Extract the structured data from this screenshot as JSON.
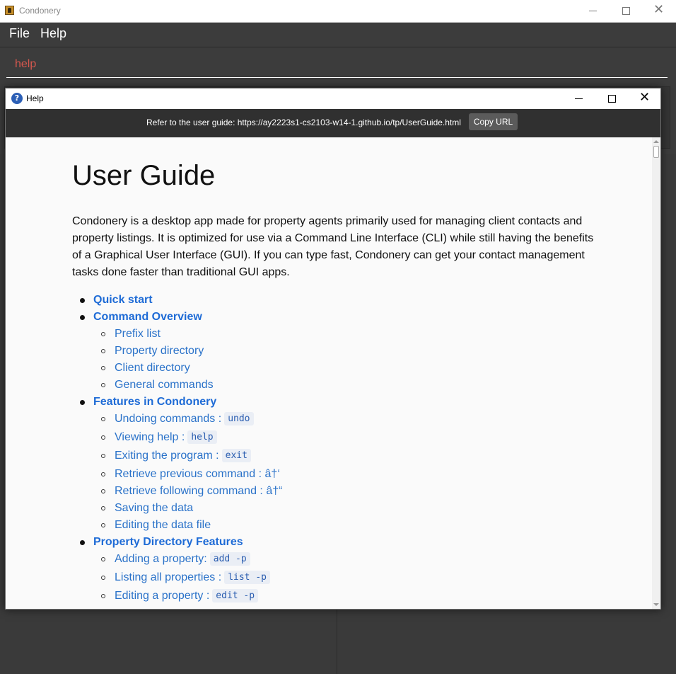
{
  "main_window": {
    "title": "Condonery",
    "menu": [
      "File",
      "Help"
    ],
    "command_input": "help"
  },
  "help_window": {
    "title": "Help",
    "url_text": "Refer to the user guide: https://ay2223s1-cs2103-w14-1.github.io/tp/UserGuide.html",
    "copy_button": "Copy URL",
    "doc_title": "User Guide",
    "intro": "Condonery is a desktop app made for property agents primarily used for managing client contacts and property listings. It is optimized for use via a Command Line Interface (CLI) while still having the benefits of a Graphical User Interface (GUI). If you can type fast, Condonery can get your contact management tasks done faster than traditional GUI apps.",
    "toc": [
      {
        "level": 1,
        "text": "Quick start"
      },
      {
        "level": 1,
        "text": "Command Overview"
      },
      {
        "level": 2,
        "text": "Prefix list"
      },
      {
        "level": 2,
        "text": "Property directory"
      },
      {
        "level": 2,
        "text": "Client directory"
      },
      {
        "level": 2,
        "text": "General commands"
      },
      {
        "level": 1,
        "text": "Features in Condonery"
      },
      {
        "level": 2,
        "text": "Undoing commands :",
        "code": "undo"
      },
      {
        "level": 2,
        "text": "Viewing help :",
        "code": "help"
      },
      {
        "level": 2,
        "text": "Exiting the program :",
        "code": "exit"
      },
      {
        "level": 2,
        "text": "Retrieve previous command : â†‘"
      },
      {
        "level": 2,
        "text": "Retrieve following command : â†“"
      },
      {
        "level": 2,
        "text": "Saving the data"
      },
      {
        "level": 2,
        "text": "Editing the data file"
      },
      {
        "level": 1,
        "text": "Property Directory Features"
      },
      {
        "level": 2,
        "text": "Adding a property:",
        "code": "add -p"
      },
      {
        "level": 2,
        "text": "Listing all properties :",
        "code": "list -p"
      },
      {
        "level": 2,
        "text": "Editing a property :",
        "code": "edit -p"
      }
    ]
  }
}
